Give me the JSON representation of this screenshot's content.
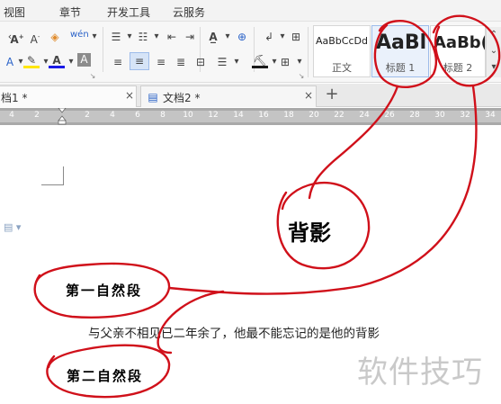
{
  "menu": {
    "items": [
      "视图",
      "章节",
      "开发工具",
      "云服务"
    ]
  },
  "ribbon": {
    "styles": [
      {
        "sample": "AaBbCcDd",
        "name": "正文"
      },
      {
        "sample": "AaBl",
        "name": "标题 1"
      },
      {
        "sample": "AaBb(",
        "name": "标题 2"
      }
    ]
  },
  "tabs": [
    {
      "label": "档1 *"
    },
    {
      "label": "文档2 *"
    }
  ],
  "new_tab_symbol": "+",
  "close_symbol": "×",
  "ruler": {
    "ticks": [
      "4",
      "2",
      "",
      "2",
      "4",
      "6",
      "8",
      "10",
      "12",
      "14",
      "16",
      "18",
      "20",
      "22",
      "24",
      "26",
      "28",
      "30",
      "32",
      "34"
    ]
  },
  "document": {
    "body_text": "与父亲不相见已二年余了，他最不能忘记的是他的背影"
  },
  "annotations": {
    "title_label": "背影",
    "para1_label": "第一自然段",
    "para2_label": "第二自然段",
    "ink_color": "#d0101a"
  },
  "watermark": "软件技巧",
  "icons": {
    "font_grow": "A⁺",
    "font_shrink": "A⁻",
    "eraser": "eraser-icon",
    "pinyin": "wén",
    "bullets": "≔",
    "numbering": "≡",
    "align_left": "≡",
    "highlight_color": "#ffe600",
    "font_color": "#1a1ae6"
  }
}
